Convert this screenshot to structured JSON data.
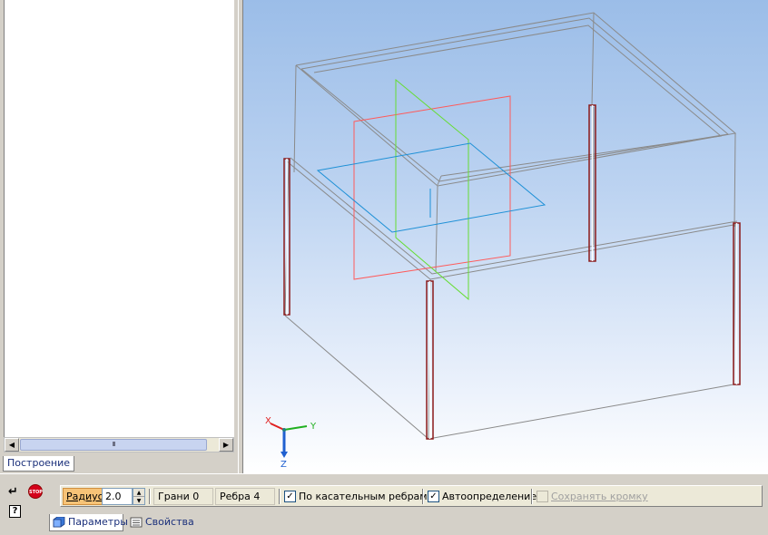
{
  "tree_panel": {
    "tab_label": "Построение",
    "scroll_thumb_grip": "III",
    "scroll_left_arrow": "◀",
    "scroll_right_arrow": "▶"
  },
  "viewport": {
    "axis_labels": {
      "x": "X",
      "y": "Y",
      "z": "Z"
    }
  },
  "toolbar": {
    "enter_icon_glyph": "↵",
    "stop_label": "STOP",
    "help_glyph": "?"
  },
  "parameters": {
    "radius_label": "Радиус",
    "radius_value": "2.0",
    "spin_up": "▲",
    "spin_down": "▼",
    "faces_field": "Грани 0",
    "edges_field": "Ребра 4",
    "tangent_edges_label": "По касательным ребрам",
    "tangent_edges_checked": "✓",
    "auto_detect_label": "Автоопределение",
    "auto_detect_checked": "✓",
    "keep_edge_label": "Сохранять кромку"
  },
  "bottom_tabs": {
    "params_label": "Параметры",
    "props_label": "Свойства"
  },
  "colors": {
    "viewport_top": "#9bbde8",
    "viewport_bottom": "#ffffff",
    "plane_red": "#ff5a5a",
    "plane_green": "#66dd33",
    "plane_blue": "#1e90d6",
    "edge_highlight": "#8b1a1a",
    "wireframe": "#808080"
  }
}
